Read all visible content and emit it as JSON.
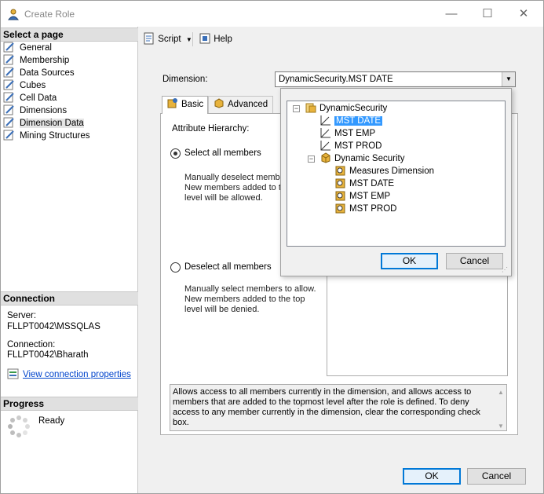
{
  "window": {
    "title": "Create Role",
    "minimize": "—",
    "maximize": "☐",
    "close": "✕"
  },
  "left": {
    "select_page_header": "Select a page",
    "pages": [
      "General",
      "Membership",
      "Data Sources",
      "Cubes",
      "Cell Data",
      "Dimensions",
      "Dimension Data",
      "Mining Structures"
    ],
    "connection_header": "Connection",
    "server_label": "Server:",
    "server_value": "FLLPT0042\\MSSQLAS",
    "connection_label": "Connection:",
    "connection_value": "FLLPT0042\\Bharath",
    "view_props_link": "View connection properties",
    "progress_header": "Progress",
    "progress_status": "Ready"
  },
  "toolbar": {
    "script": "Script",
    "help": "Help"
  },
  "main": {
    "dimension_label": "Dimension:",
    "dimension_value": "DynamicSecurity.MST DATE",
    "tab_basic": "Basic",
    "tab_advanced": "Advanced",
    "attribute_hierarchy_label": "Attribute Hierarchy:",
    "select_all_label": "Select all members",
    "select_all_desc": [
      "Manually deselect member",
      "New members added to th",
      "level will be allowed."
    ],
    "deselect_all_label": "Deselect all members",
    "deselect_all_desc": [
      "Manually select members to allow.",
      "New members added to the top",
      "level will be denied."
    ],
    "info_text": "Allows access to all members currently in the dimension, and allows access to members that are added to the topmost level after the role is defined. To deny access to any member currently in the dimension, clear the corresponding check box."
  },
  "popup": {
    "tree": {
      "root": "DynamicSecurity",
      "root_children": [
        "MST DATE",
        "MST EMP",
        "MST PROD"
      ],
      "cube": "Dynamic Security",
      "cube_children": [
        "Measures Dimension",
        "MST DATE",
        "MST EMP",
        "MST PROD"
      ]
    },
    "ok": "OK",
    "cancel": "Cancel"
  },
  "footer": {
    "ok": "OK",
    "cancel": "Cancel"
  }
}
